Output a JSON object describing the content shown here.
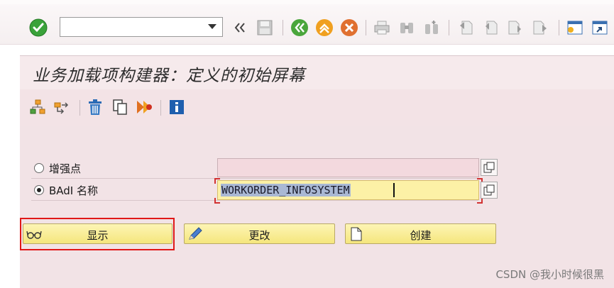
{
  "toolbar": {
    "command_field_value": "",
    "command_field_placeholder": ""
  },
  "screen": {
    "title": "业务加载项构建器：定义的初始屏幕"
  },
  "form": {
    "option_enhancement_point": "增强点",
    "option_badi_name": "BAdI 名称",
    "enhancement_point_value": "",
    "badi_name_value": "WORKORDER_INFOSYSTEM",
    "selected_option": "badi"
  },
  "buttons": {
    "display": "显示",
    "change": "更改",
    "create": "创建"
  },
  "watermark": "CSDN @我小时候很黑",
  "colors": {
    "title_bg": "#f6eaec",
    "content_bg": "#f2e3e6",
    "button_yellow": "#f8ec90",
    "highlight_red": "#e01818",
    "input_yellow": "#fcf1a6"
  }
}
